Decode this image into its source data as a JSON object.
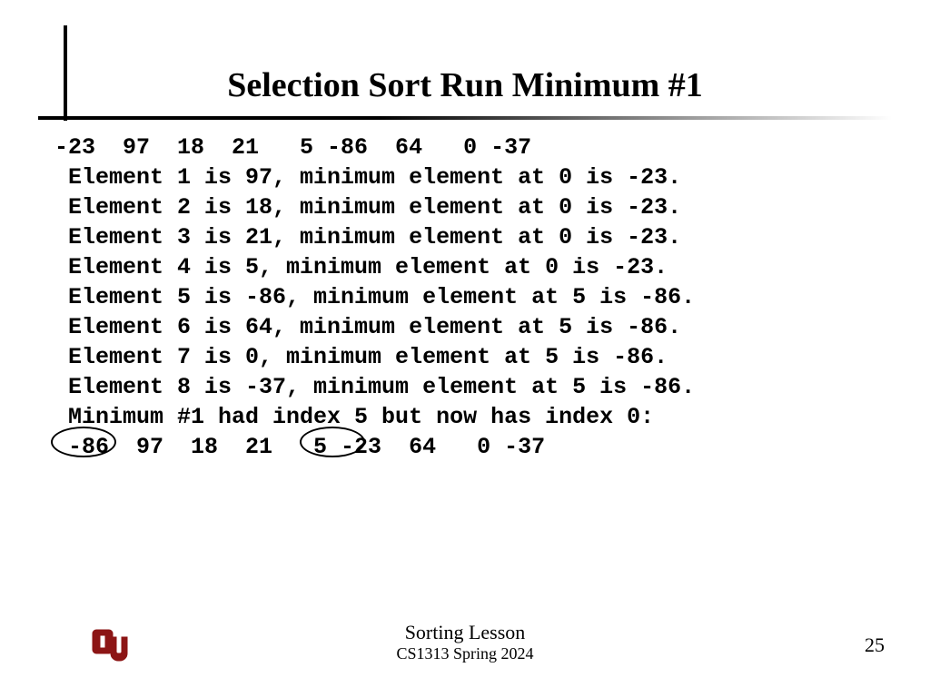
{
  "title": "Selection Sort Run Minimum #1",
  "body_lines": [
    "-23  97  18  21   5 -86  64   0 -37",
    " Element 1 is 97, minimum element at 0 is -23.",
    " Element 2 is 18, minimum element at 0 is -23.",
    " Element 3 is 21, minimum element at 0 is -23.",
    " Element 4 is 5, minimum element at 0 is -23.",
    " Element 5 is -86, minimum element at 5 is -86.",
    " Element 6 is 64, minimum element at 5 is -86.",
    " Element 7 is 0, minimum element at 5 is -86.",
    " Element 8 is -37, minimum element at 5 is -86.",
    " Minimum #1 had index 5 but now has index 0:",
    " -86  97  18  21   5 -23  64   0 -37"
  ],
  "footer": {
    "title": "Sorting Lesson",
    "course": "CS1313 Spring 2024",
    "page": "25"
  },
  "logo_color": "#8c1515"
}
